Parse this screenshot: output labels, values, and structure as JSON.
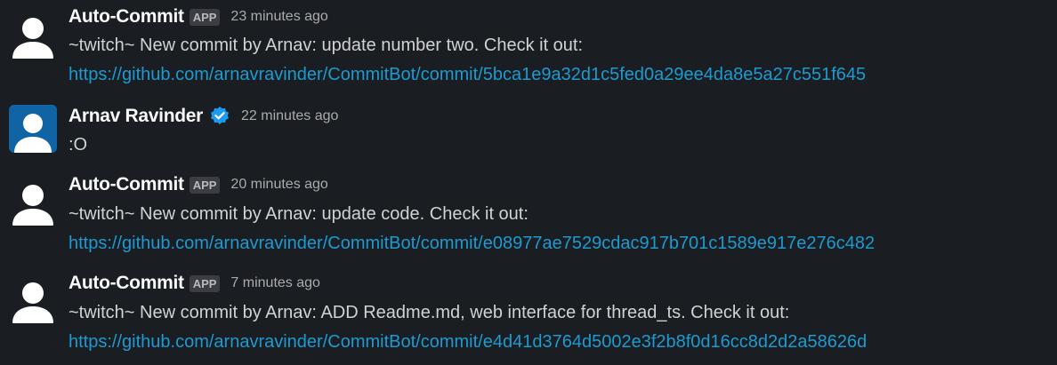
{
  "messages": [
    {
      "author": "Auto-Commit",
      "badge": "APP",
      "time": "23 minutes ago",
      "text": "~twitch~ New commit by Arnav: update number two. Check it out:",
      "link": "https://github.com/arnavravinder/CommitBot/commit/5bca1e9a32d1c5fed0a29ee4da8e5a27c551f645"
    },
    {
      "author": "Arnav Ravinder",
      "verified_icon": "verified-badge-icon",
      "time": "22 minutes ago",
      "text": ":O"
    },
    {
      "author": "Auto-Commit",
      "badge": "APP",
      "time": "20 minutes ago",
      "text": "~twitch~ New commit by Arnav: update code. Check it out:",
      "link": "https://github.com/arnavravinder/CommitBot/commit/e08977ae7529cdac917b701c1589e917e276c482"
    },
    {
      "author": "Auto-Commit",
      "badge": "APP",
      "time": "7 minutes ago",
      "text": "~twitch~ New commit by Arnav: ADD Readme.md, web interface for thread_ts. Check it out:",
      "link": "https://github.com/arnavravinder/CommitBot/commit/e4d41d3764d5002e3f2b8f0d16cc8d2d2a58626d"
    }
  ],
  "colors": {
    "background": "#1a1d21",
    "link": "#1d9bd1",
    "text": "#d1d2d3",
    "timestamp": "#ababad",
    "badge_bg": "#3b3d42",
    "verified": "#1d9bf0",
    "human_avatar_bg": "#1164a3"
  }
}
